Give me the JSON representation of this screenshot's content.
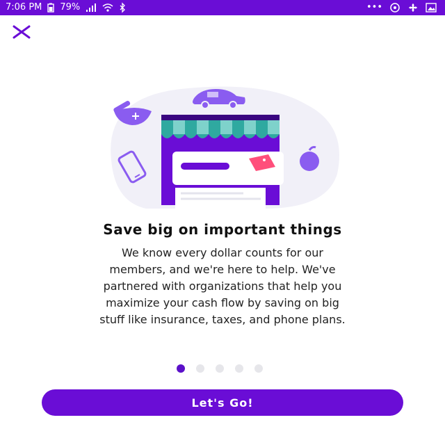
{
  "status_bar": {
    "time": "7:06 PM",
    "battery": "79%",
    "icons": [
      "battery-icon",
      "signal-icon",
      "wifi-icon",
      "bluetooth-icon",
      "more-dots-icon",
      "alarm-icon",
      "fan-icon",
      "image-icon"
    ]
  },
  "close_icon": "close-icon",
  "onboarding": {
    "headline": "Save big on important things",
    "body_lines": [
      "We know every dollar counts for our",
      "members, and we're here to help. We've",
      "partnered with organizations that help you",
      "maximize your cash flow by saving on big",
      "stuff like insurance, taxes, and phone plans."
    ],
    "page_count": 5,
    "active_page": 1
  },
  "cta": {
    "label": "Let's Go!"
  },
  "colors": {
    "brand_purple": "#6a0dd6",
    "dot_inactive": "#e6e6ea",
    "illustration_purple": "#8a5cf0",
    "awning_teal": "#2fa9a0",
    "tag_pink": "#ff4f7b"
  }
}
